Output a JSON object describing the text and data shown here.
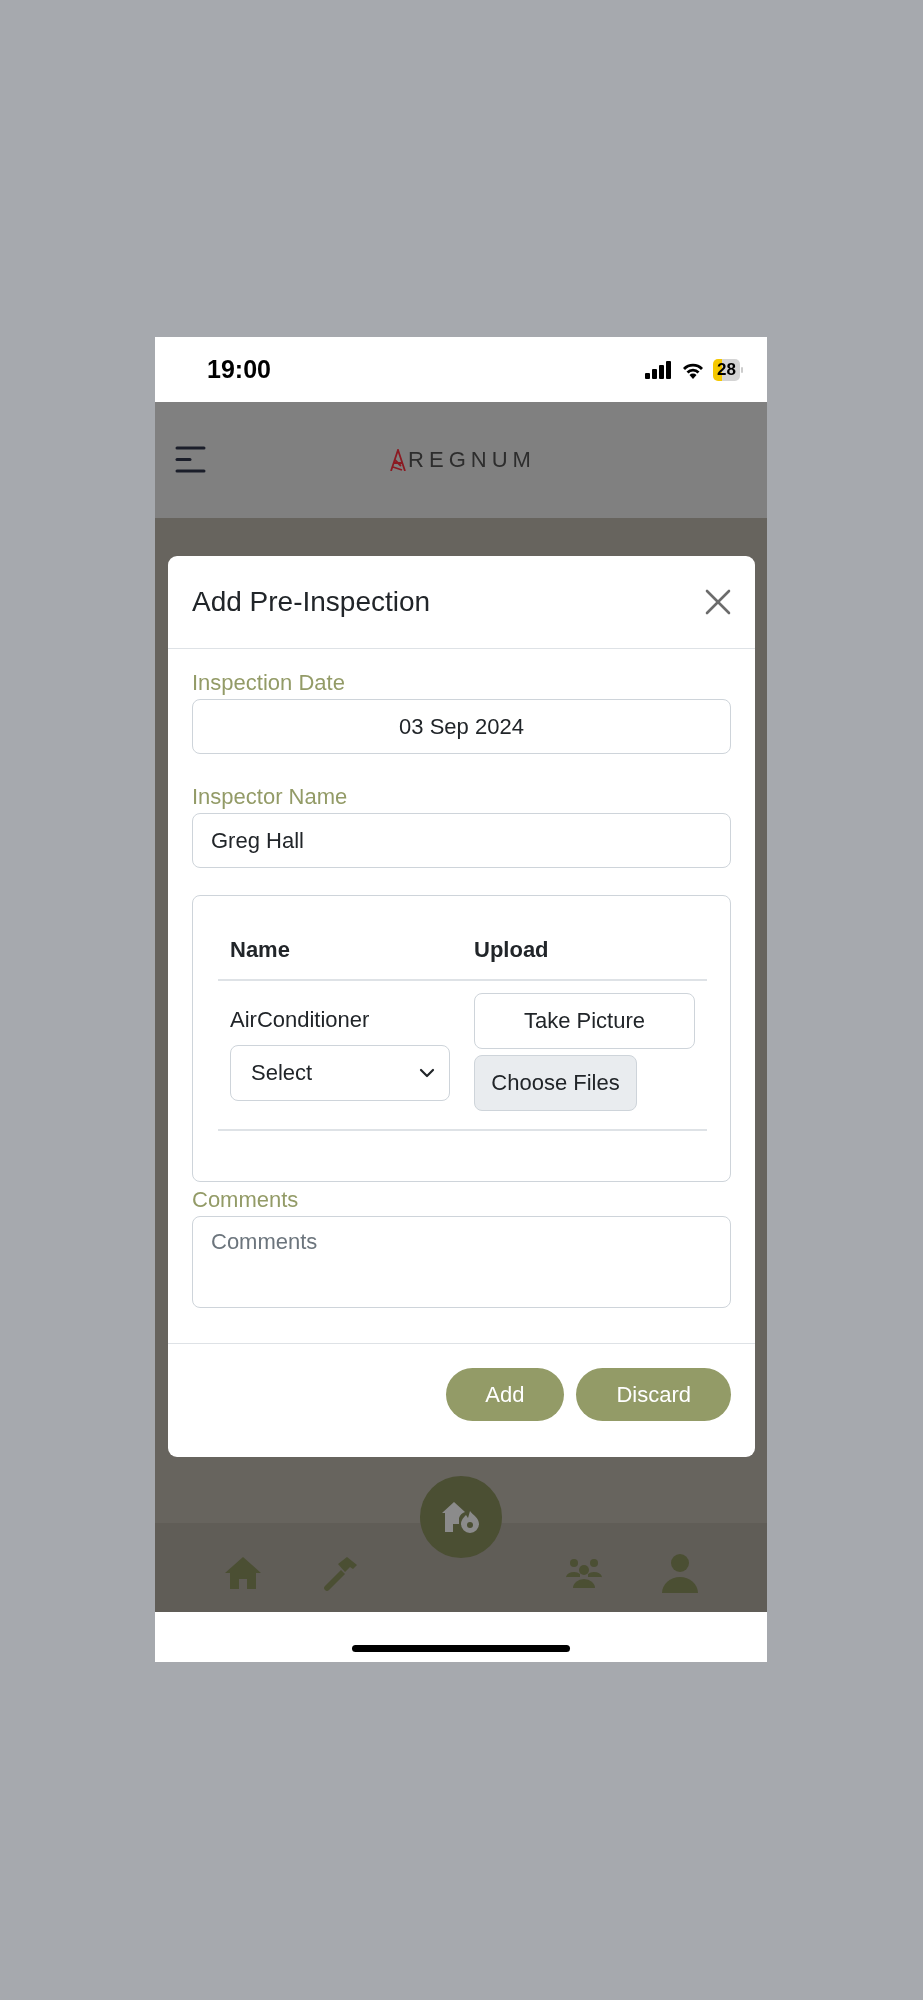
{
  "status_bar": {
    "time": "19:00",
    "battery": "28"
  },
  "header": {
    "logo_text": "REGNUM"
  },
  "modal": {
    "title": "Add Pre-Inspection",
    "fields": [
      {
        "label": "Inspection Date",
        "value": "03 Sep 2024",
        "kind": "date"
      },
      {
        "label": "Inspector Name",
        "value": "Greg Hall",
        "kind": "text"
      }
    ],
    "table": {
      "columns": [
        "Name",
        "Upload"
      ],
      "rows": [
        {
          "name": "AirConditioner",
          "select": "Select",
          "buttons": [
            {
              "label": "Take Picture",
              "kind": "outline"
            },
            {
              "label": "Choose Files",
              "kind": "file"
            }
          ]
        }
      ]
    },
    "comments": {
      "label": "Comments",
      "placeholder": "Comments"
    },
    "buttons": [
      "Add",
      "Discard"
    ]
  }
}
